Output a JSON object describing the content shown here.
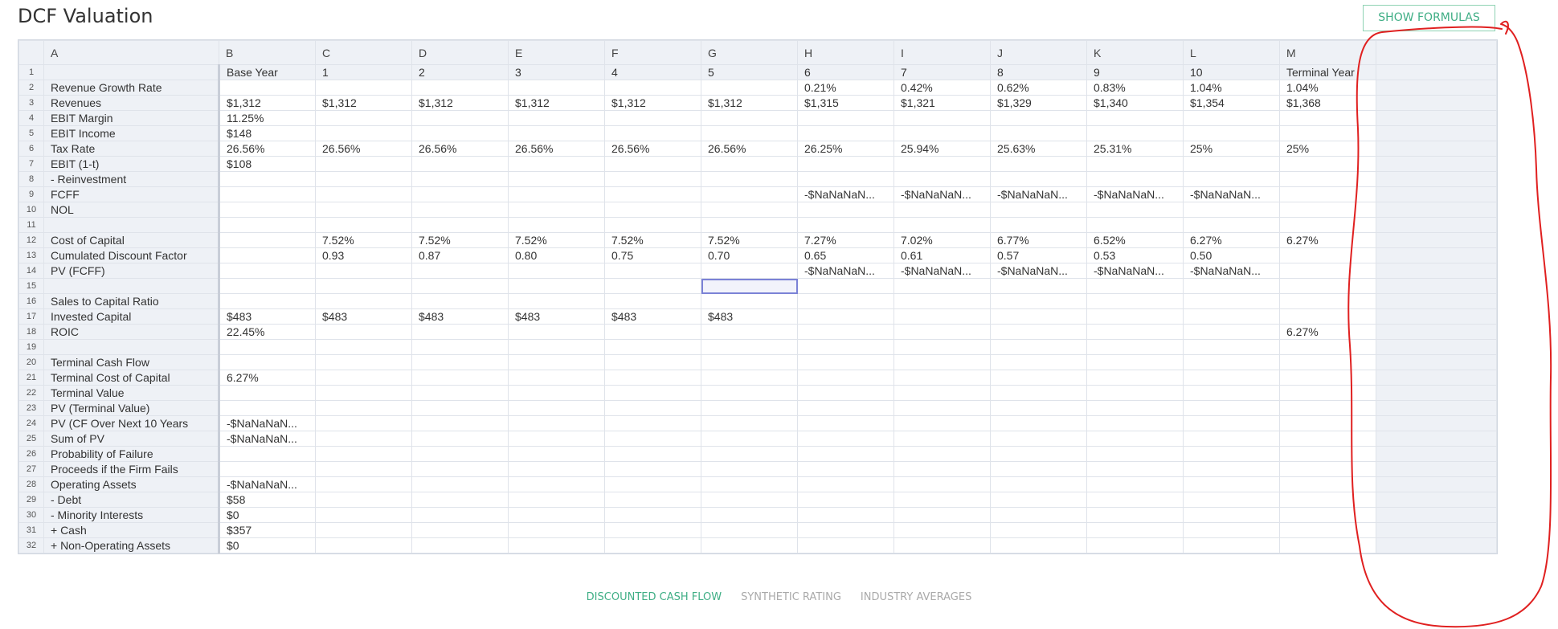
{
  "page": {
    "title": "DCF Valuation",
    "show_formulas_label": "SHOW FORMULAS"
  },
  "sheet": {
    "columns": [
      "A",
      "B",
      "C",
      "D",
      "E",
      "F",
      "G",
      "H",
      "I",
      "J",
      "K",
      "L",
      "M",
      ""
    ],
    "rows": [
      [
        "",
        "Base Year",
        "1",
        "2",
        "3",
        "4",
        "5",
        "6",
        "7",
        "8",
        "9",
        "10",
        "Terminal Year"
      ],
      [
        "Revenue Growth Rate",
        "",
        "",
        "",
        "",
        "",
        "",
        "0.21%",
        "0.42%",
        "0.62%",
        "0.83%",
        "1.04%",
        "1.04%"
      ],
      [
        "Revenues",
        "$1,312",
        "$1,312",
        "$1,312",
        "$1,312",
        "$1,312",
        "$1,312",
        "$1,315",
        "$1,321",
        "$1,329",
        "$1,340",
        "$1,354",
        "$1,368"
      ],
      [
        "EBIT Margin",
        "11.25%",
        "",
        "",
        "",
        "",
        "",
        "",
        "",
        "",
        "",
        "",
        ""
      ],
      [
        "EBIT Income",
        "$148",
        "",
        "",
        "",
        "",
        "",
        "",
        "",
        "",
        "",
        "",
        ""
      ],
      [
        "Tax Rate",
        "26.56%",
        "26.56%",
        "26.56%",
        "26.56%",
        "26.56%",
        "26.56%",
        "26.25%",
        "25.94%",
        "25.63%",
        "25.31%",
        "25%",
        "25%"
      ],
      [
        "EBIT (1-t)",
        "$108",
        "",
        "",
        "",
        "",
        "",
        "",
        "",
        "",
        "",
        "",
        ""
      ],
      [
        "- Reinvestment",
        "",
        "",
        "",
        "",
        "",
        "",
        "",
        "",
        "",
        "",
        "",
        ""
      ],
      [
        "FCFF",
        "",
        "",
        "",
        "",
        "",
        "",
        "-$NaNaNaN...",
        "-$NaNaNaN...",
        "-$NaNaNaN...",
        "-$NaNaNaN...",
        "-$NaNaNaN...",
        ""
      ],
      [
        "NOL",
        "",
        "",
        "",
        "",
        "",
        "",
        "",
        "",
        "",
        "",
        "",
        ""
      ],
      [
        "",
        "",
        "",
        "",
        "",
        "",
        "",
        "",
        "",
        "",
        "",
        "",
        ""
      ],
      [
        "Cost of Capital",
        "",
        "7.52%",
        "7.52%",
        "7.52%",
        "7.52%",
        "7.52%",
        "7.27%",
        "7.02%",
        "6.77%",
        "6.52%",
        "6.27%",
        "6.27%"
      ],
      [
        "Cumulated Discount Factor",
        "",
        "0.93",
        "0.87",
        "0.80",
        "0.75",
        "0.70",
        "0.65",
        "0.61",
        "0.57",
        "0.53",
        "0.50",
        ""
      ],
      [
        "PV (FCFF)",
        "",
        "",
        "",
        "",
        "",
        "",
        "-$NaNaNaN...",
        "-$NaNaNaN...",
        "-$NaNaNaN...",
        "-$NaNaNaN...",
        "-$NaNaNaN...",
        ""
      ],
      [
        "",
        "",
        "",
        "",
        "",
        "",
        "",
        "",
        "",
        "",
        "",
        "",
        ""
      ],
      [
        "Sales to Capital Ratio",
        "",
        "",
        "",
        "",
        "",
        "",
        "",
        "",
        "",
        "",
        "",
        ""
      ],
      [
        "Invested Capital",
        "$483",
        "$483",
        "$483",
        "$483",
        "$483",
        "$483",
        "",
        "",
        "",
        "",
        "",
        ""
      ],
      [
        "ROIC",
        "22.45%",
        "",
        "",
        "",
        "",
        "",
        "",
        "",
        "",
        "",
        "",
        "6.27%"
      ],
      [
        "",
        "",
        "",
        "",
        "",
        "",
        "",
        "",
        "",
        "",
        "",
        "",
        ""
      ],
      [
        "Terminal Cash Flow",
        "",
        "",
        "",
        "",
        "",
        "",
        "",
        "",
        "",
        "",
        "",
        ""
      ],
      [
        "Terminal Cost of Capital",
        "6.27%",
        "",
        "",
        "",
        "",
        "",
        "",
        "",
        "",
        "",
        "",
        ""
      ],
      [
        "Terminal Value",
        "",
        "",
        "",
        "",
        "",
        "",
        "",
        "",
        "",
        "",
        "",
        ""
      ],
      [
        "PV (Terminal Value)",
        "",
        "",
        "",
        "",
        "",
        "",
        "",
        "",
        "",
        "",
        "",
        ""
      ],
      [
        "PV (CF Over Next 10 Years",
        "-$NaNaNaN...",
        "",
        "",
        "",
        "",
        "",
        "",
        "",
        "",
        "",
        "",
        ""
      ],
      [
        "Sum of PV",
        "-$NaNaNaN...",
        "",
        "",
        "",
        "",
        "",
        "",
        "",
        "",
        "",
        "",
        ""
      ],
      [
        "Probability of Failure",
        "",
        "",
        "",
        "",
        "",
        "",
        "",
        "",
        "",
        "",
        "",
        ""
      ],
      [
        "Proceeds if the Firm Fails",
        "",
        "",
        "",
        "",
        "",
        "",
        "",
        "",
        "",
        "",
        "",
        ""
      ],
      [
        "Operating Assets",
        "-$NaNaNaN...",
        "",
        "",
        "",
        "",
        "",
        "",
        "",
        "",
        "",
        "",
        ""
      ],
      [
        "- Debt",
        "$58",
        "",
        "",
        "",
        "",
        "",
        "",
        "",
        "",
        "",
        "",
        ""
      ],
      [
        "- Minority Interests",
        "$0",
        "",
        "",
        "",
        "",
        "",
        "",
        "",
        "",
        "",
        "",
        ""
      ],
      [
        "+ Cash",
        "$357",
        "",
        "",
        "",
        "",
        "",
        "",
        "",
        "",
        "",
        "",
        ""
      ],
      [
        "+ Non-Operating Assets",
        "$0",
        "",
        "",
        "",
        "",
        "",
        "",
        "",
        "",
        "",
        "",
        ""
      ]
    ],
    "selected_cell": {
      "row": 15,
      "column": "G"
    }
  },
  "tabs": [
    {
      "label": "DISCOUNTED CASH FLOW",
      "active": true
    },
    {
      "label": "SYNTHETIC RATING",
      "active": false
    },
    {
      "label": "INDUSTRY AVERAGES",
      "active": false
    }
  ],
  "colors": {
    "accent": "#3fae85",
    "header_bg": "#eef1f6",
    "annotation": "#e02020"
  }
}
